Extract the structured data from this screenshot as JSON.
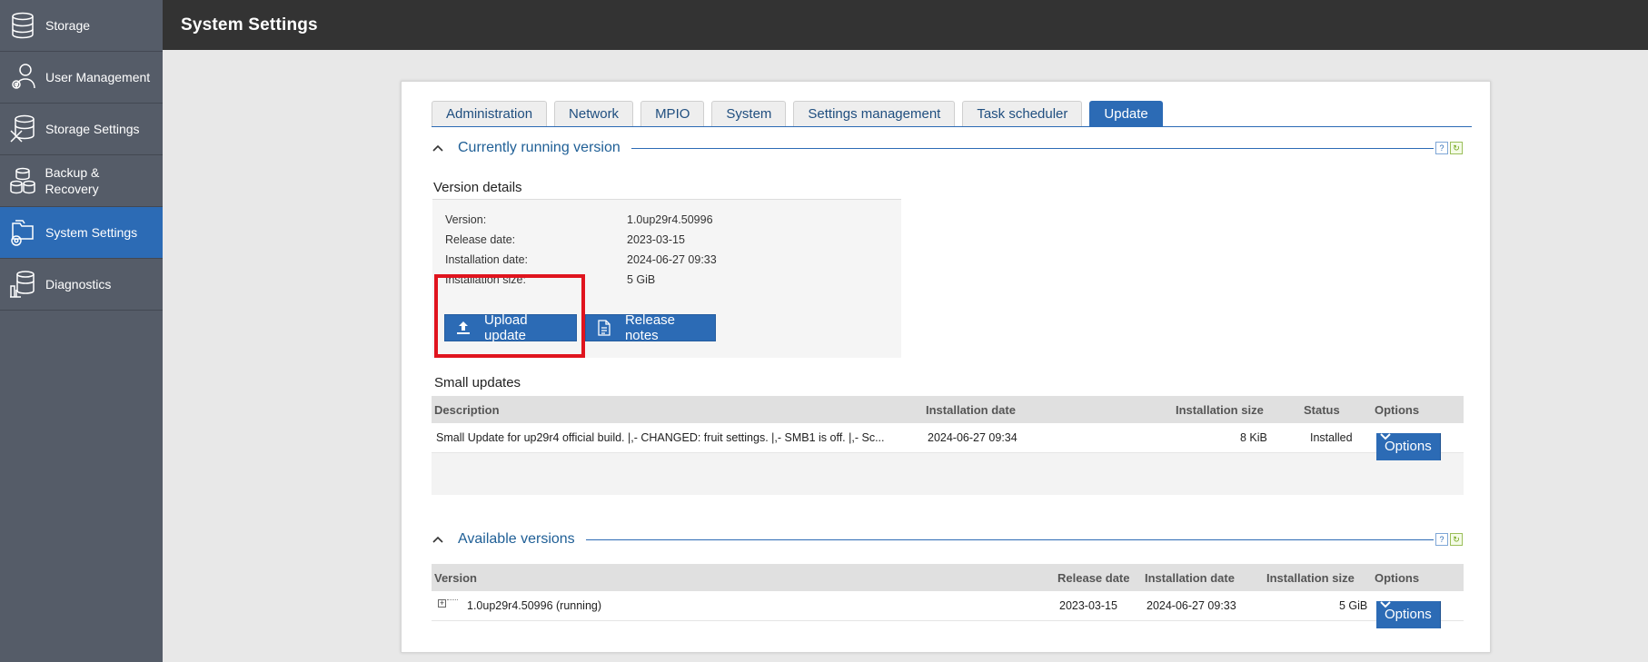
{
  "sidebar": {
    "items": [
      {
        "label": "Storage",
        "icon": "database-icon"
      },
      {
        "label": "User Management",
        "icon": "user-gear-icon"
      },
      {
        "label": "Storage Settings",
        "icon": "database-tools-icon"
      },
      {
        "label": "Backup & Recovery",
        "icon": "backup-icon"
      },
      {
        "label": "System Settings",
        "icon": "folder-gear-icon",
        "active": true
      },
      {
        "label": "Diagnostics",
        "icon": "database-chart-icon"
      }
    ]
  },
  "header": {
    "title": "System Settings"
  },
  "tabs": [
    {
      "label": "Administration"
    },
    {
      "label": "Network"
    },
    {
      "label": "MPIO"
    },
    {
      "label": "System"
    },
    {
      "label": "Settings management"
    },
    {
      "label": "Task scheduler"
    },
    {
      "label": "Update",
      "active": true
    }
  ],
  "current_version": {
    "section_title": "Currently running version",
    "details_title": "Version details",
    "details": [
      {
        "key": "Version:",
        "value": "1.0up29r4.50996"
      },
      {
        "key": "Release date:",
        "value": "2023-03-15"
      },
      {
        "key": "Installation date:",
        "value": "2024-06-27 09:33"
      },
      {
        "key": "Installation size:",
        "value": "5 GiB"
      }
    ],
    "upload_label": "Upload update",
    "release_notes_label": "Release notes"
  },
  "small_updates": {
    "title": "Small updates",
    "columns": [
      "Description",
      "Installation date",
      "Installation size",
      "Status",
      "Options"
    ],
    "rows": [
      {
        "description": "Small Update for up29r4 official build. |,- CHANGED: fruit settings. |,- SMB1 is off. |,- Sc...",
        "installation_date": "2024-06-27 09:34",
        "installation_size": "8 KiB",
        "status": "Installed",
        "options_label": "Options"
      }
    ]
  },
  "available_versions": {
    "section_title": "Available versions",
    "columns": [
      "Version",
      "Release date",
      "Installation date",
      "Installation size",
      "Options"
    ],
    "rows": [
      {
        "version": "1.0up29r4.50996 (running)",
        "release_date": "2023-03-15",
        "installation_date": "2024-06-27 09:33",
        "installation_size": "5 GiB",
        "options_label": "Options"
      }
    ]
  },
  "section_buttons": {
    "help": "?",
    "refresh": "↻"
  },
  "colors": {
    "accent": "#2c6bb5",
    "sidebar": "#555c68",
    "header": "#333333",
    "highlight": "#e0141e"
  }
}
